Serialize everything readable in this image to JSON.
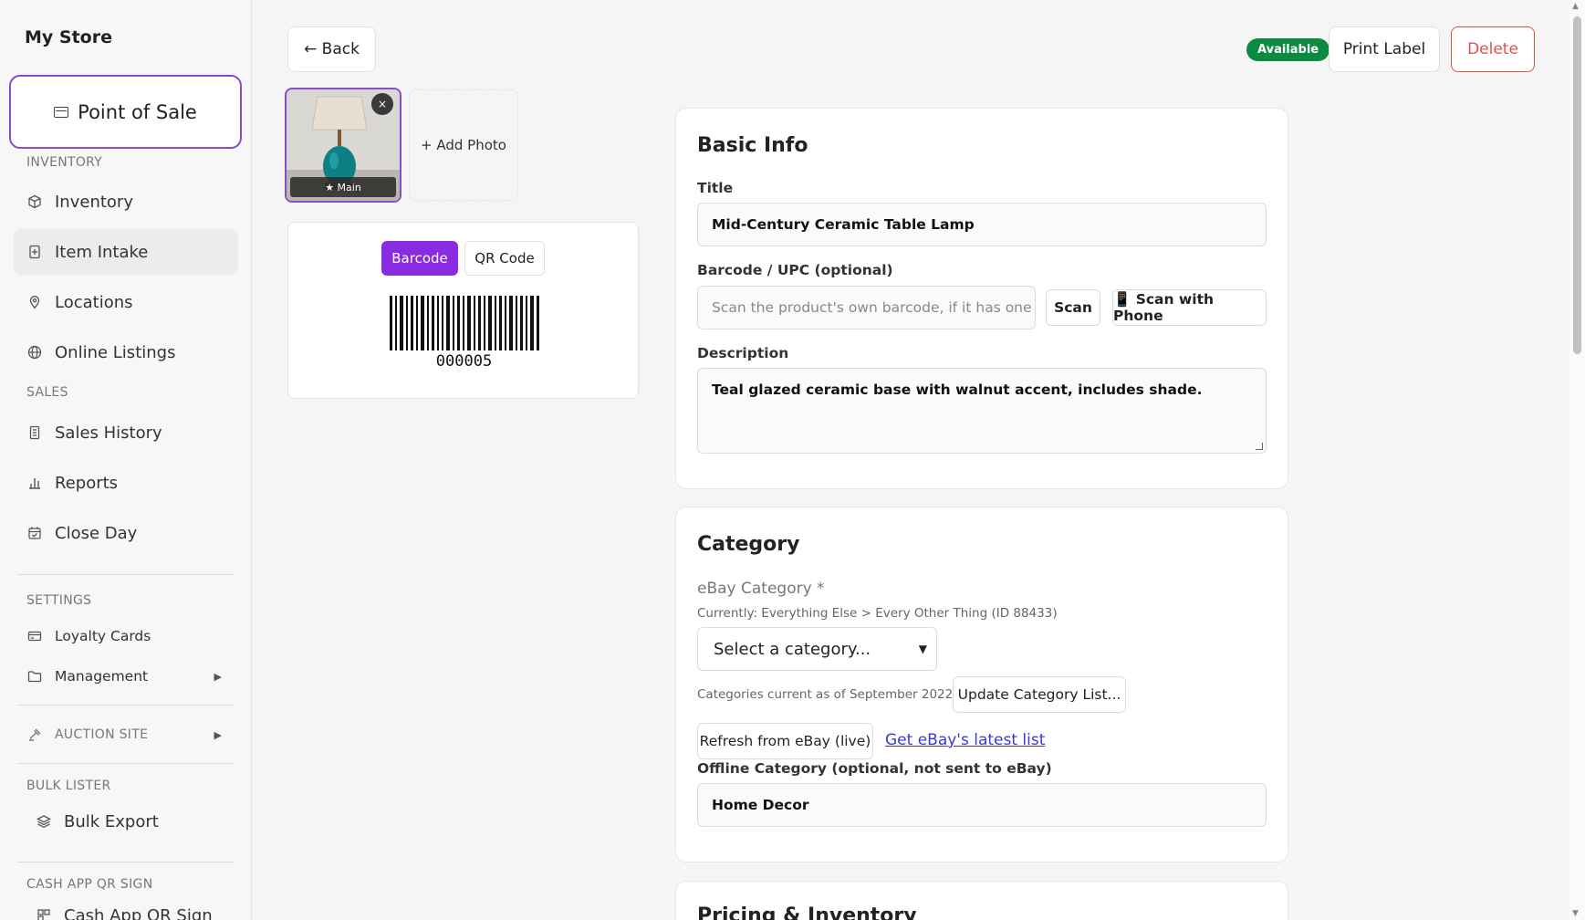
{
  "sidebar": {
    "store_name": "My Store",
    "pos_label": "Point of Sale",
    "sections": {
      "inventory": "INVENTORY",
      "sales": "SALES",
      "settings": "SETTINGS",
      "auction": "AUCTION SITE",
      "bulk": "BULK LISTER",
      "cashapp": "CASH APP QR SIGN"
    },
    "items": {
      "inventory": "Inventory",
      "item_intake": "Item Intake",
      "locations": "Locations",
      "online_listings": "Online Listings",
      "sales_history": "Sales History",
      "reports": "Reports",
      "close_day": "Close Day",
      "loyalty_cards": "Loyalty Cards",
      "management": "Management",
      "bulk_export": "Bulk Export",
      "cash_app_qr": "Cash App QR Sign"
    }
  },
  "topbar": {
    "back_label": "← Back",
    "status_badge": "Available",
    "print_label": "Print Label",
    "delete_label": "Delete"
  },
  "photos": {
    "main_label": "★ Main",
    "close_glyph": "×",
    "add_photo_label": "+ Add Photo"
  },
  "barcode": {
    "tab_barcode": "Barcode",
    "tab_qr": "QR Code",
    "number": "000005"
  },
  "basic_info": {
    "heading": "Basic Info",
    "title_label": "Title",
    "title_value": "Mid-Century Ceramic Table Lamp",
    "barcode_label": "Barcode / UPC (optional)",
    "barcode_placeholder": "Scan the product's own barcode, if it has one",
    "scan_label": "Scan",
    "scan_phone_label": "📱 Scan with Phone",
    "description_label": "Description",
    "description_value": "Teal glazed ceramic base with walnut accent, includes shade."
  },
  "category": {
    "heading": "Category",
    "ebay_label": "eBay Category *",
    "current_note": "Currently: Everything Else > Every Other Thing (ID 88433)",
    "select_value": "Select a category...",
    "current_as_of": "Categories current as of September 2022.",
    "update_btn": "Update Category List...",
    "refresh_btn": "Refresh from eBay (live)",
    "latest_link": "Get eBay's latest list",
    "offline_label": "Offline Category (optional, not sent to eBay)",
    "offline_value": "Home Decor"
  },
  "pricing": {
    "heading": "Pricing & Inventory"
  },
  "colors": {
    "accent": "#8a2be2",
    "available": "#0c8a3f",
    "danger": "#d9534f",
    "link": "#3a3ad6"
  }
}
